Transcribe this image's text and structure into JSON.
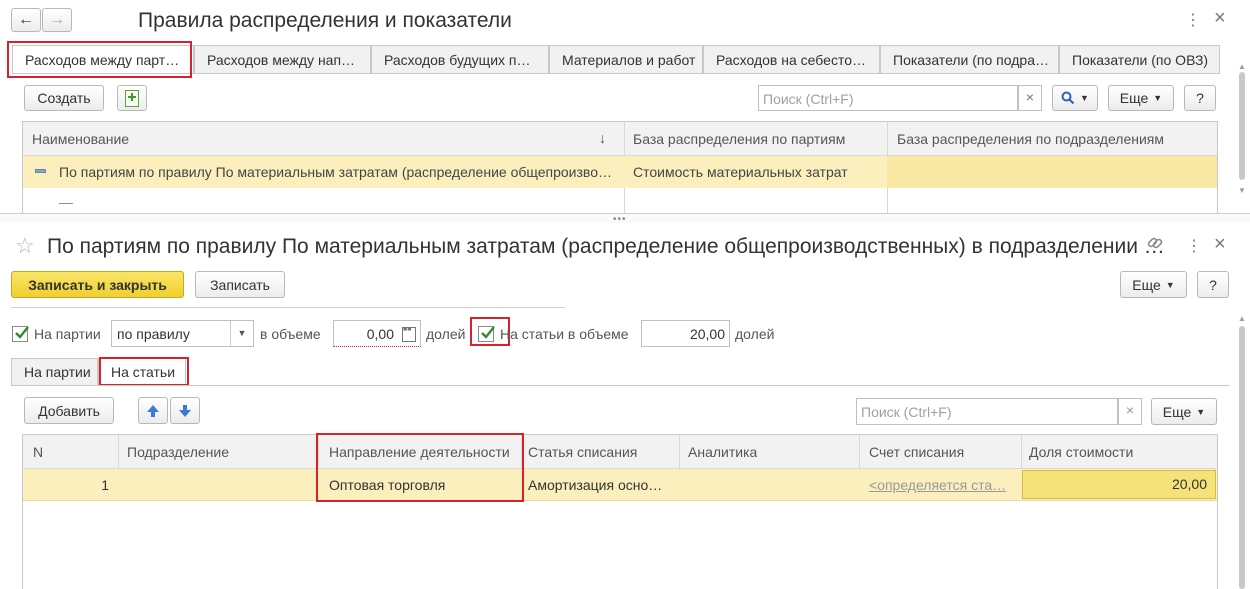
{
  "top_window": {
    "title": "Правила распределения и показатели",
    "tabs": [
      "Расходов между парт…",
      "Расходов между нап…",
      "Расходов будущих п…",
      "Материалов и работ",
      "Расходов на себесто…",
      "Показатели (по подра…",
      "Показатели (по ОВЗ)"
    ],
    "create_label": "Создать",
    "search_placeholder": "Поиск (Ctrl+F)",
    "more_label": "Еще",
    "help_label": "?",
    "clear_label": "×",
    "columns": [
      "Наименование",
      "База распределения по партиям",
      "База распределения по подразделениям"
    ],
    "sort_indicator": "↓",
    "rows": [
      {
        "name": "По партиям по правилу По материальным затратам (распределение общепроизво…",
        "base_batches": "Стоимость материальных затрат",
        "base_divisions": ""
      }
    ]
  },
  "form": {
    "title": "По партиям по правилу По материальным затратам (распределение общепроизводственных) в подразделении …",
    "save_close_label": "Записать и закрыть",
    "save_label": "Записать",
    "more_label": "Еще",
    "help_label": "?",
    "batches_checkbox_label": "На партии",
    "rule_value": "по правилу",
    "in_volume_label": "в объеме",
    "batches_volume": "0,00",
    "shares_label": "долей",
    "articles_checkbox_label": "На статьи в объеме",
    "articles_volume": "20,00",
    "articles_shares_label": "долей",
    "subtabs": [
      "На партии",
      "На статьи"
    ],
    "add_label": "Добавить",
    "search_placeholder": "Поиск (Ctrl+F)",
    "clear_label": "×",
    "columns": [
      "N",
      "Подразделение",
      "Направление деятельности",
      "Статья списания",
      "Аналитика",
      "Счет списания",
      "Доля стоимости"
    ],
    "rows": [
      {
        "n": "1",
        "division": "",
        "direction": "Оптовая торговля",
        "article": "Амортизация осно…",
        "analytics": "",
        "account": "<определяется ста…",
        "share": "20,00"
      }
    ]
  },
  "colors": {
    "accent_yellow": "#f5dc4c",
    "highlight_red": "#d6222a",
    "row_selected": "#fbefbe"
  }
}
